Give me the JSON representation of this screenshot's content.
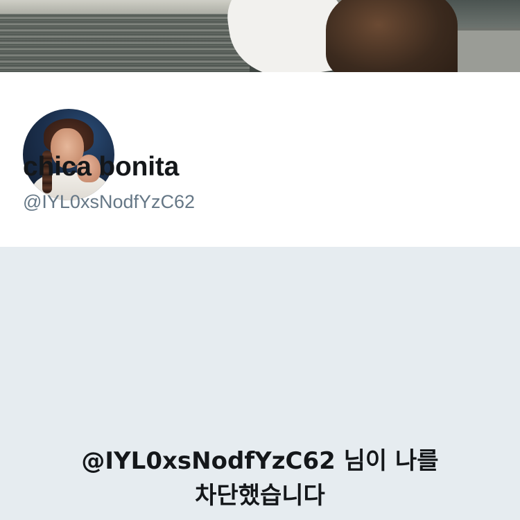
{
  "profile": {
    "display_name": "chica bonita",
    "handle": "@IYL0xsNodfYzC62"
  },
  "blocked": {
    "line1": "@IYL0xsNodfYzC62 님이 나를",
    "line2": "차단했습니다"
  },
  "colors": {
    "name_text": "#14171a",
    "handle_text": "#657786",
    "blocked_background": "#e6ecf0"
  }
}
